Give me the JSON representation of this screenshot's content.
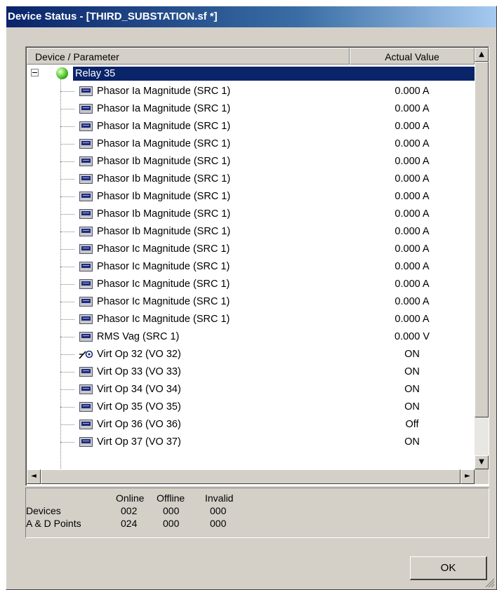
{
  "window": {
    "title": "Device Status - [THIRD_SUBSTATION.sf *]"
  },
  "table": {
    "columns": {
      "device": "Device / Parameter",
      "value": "Actual Value"
    },
    "root": {
      "label": "Relay 35",
      "status_color": "#2c9a16"
    },
    "rows": [
      {
        "name": "Phasor Ia Magnitude (SRC 1)",
        "value": "0.000 A",
        "icon": "parameter-icon"
      },
      {
        "name": "Phasor Ia Magnitude (SRC 1)",
        "value": "0.000 A",
        "icon": "parameter-icon"
      },
      {
        "name": "Phasor Ia Magnitude (SRC 1)",
        "value": "0.000 A",
        "icon": "parameter-icon"
      },
      {
        "name": "Phasor Ia Magnitude (SRC 1)",
        "value": "0.000 A",
        "icon": "parameter-icon"
      },
      {
        "name": "Phasor Ib Magnitude (SRC 1)",
        "value": "0.000 A",
        "icon": "parameter-icon"
      },
      {
        "name": "Phasor Ib Magnitude (SRC 1)",
        "value": "0.000 A",
        "icon": "parameter-icon"
      },
      {
        "name": "Phasor Ib Magnitude (SRC 1)",
        "value": "0.000 A",
        "icon": "parameter-icon"
      },
      {
        "name": "Phasor Ib Magnitude (SRC 1)",
        "value": "0.000 A",
        "icon": "parameter-icon"
      },
      {
        "name": "Phasor Ib Magnitude (SRC 1)",
        "value": "0.000 A",
        "icon": "parameter-icon"
      },
      {
        "name": "Phasor Ic Magnitude (SRC 1)",
        "value": "0.000 A",
        "icon": "parameter-icon"
      },
      {
        "name": "Phasor Ic Magnitude (SRC 1)",
        "value": "0.000 A",
        "icon": "parameter-icon"
      },
      {
        "name": "Phasor Ic Magnitude (SRC 1)",
        "value": "0.000 A",
        "icon": "parameter-icon"
      },
      {
        "name": "Phasor Ic Magnitude (SRC 1)",
        "value": "0.000 A",
        "icon": "parameter-icon"
      },
      {
        "name": "Phasor Ic Magnitude (SRC 1)",
        "value": "0.000 A",
        "icon": "parameter-icon"
      },
      {
        "name": "RMS Vag (SRC 1)",
        "value": "0.000 V",
        "icon": "parameter-icon"
      },
      {
        "name": "Virt Op 32 (VO 32)",
        "value": "ON",
        "icon": "switch-icon"
      },
      {
        "name": "Virt Op 33 (VO 33)",
        "value": "ON",
        "icon": "parameter-icon"
      },
      {
        "name": "Virt Op 34 (VO 34)",
        "value": "ON",
        "icon": "parameter-icon"
      },
      {
        "name": "Virt Op 35 (VO 35)",
        "value": "ON",
        "icon": "parameter-icon"
      },
      {
        "name": "Virt Op 36 (VO 36)",
        "value": "Off",
        "icon": "parameter-icon"
      },
      {
        "name": "Virt Op 37 (VO 37)",
        "value": "ON",
        "icon": "parameter-icon"
      }
    ]
  },
  "summary": {
    "headers": [
      "Online",
      "Offline",
      "Invalid"
    ],
    "devices": {
      "label": "Devices",
      "online": "002",
      "offline": "000",
      "invalid": "000"
    },
    "points": {
      "label": "A & D Points",
      "online": "024",
      "offline": "000",
      "invalid": "000"
    }
  },
  "buttons": {
    "ok": "OK"
  },
  "scroll": {
    "up": "▲",
    "down": "▼",
    "left": "◄",
    "right": "►"
  }
}
